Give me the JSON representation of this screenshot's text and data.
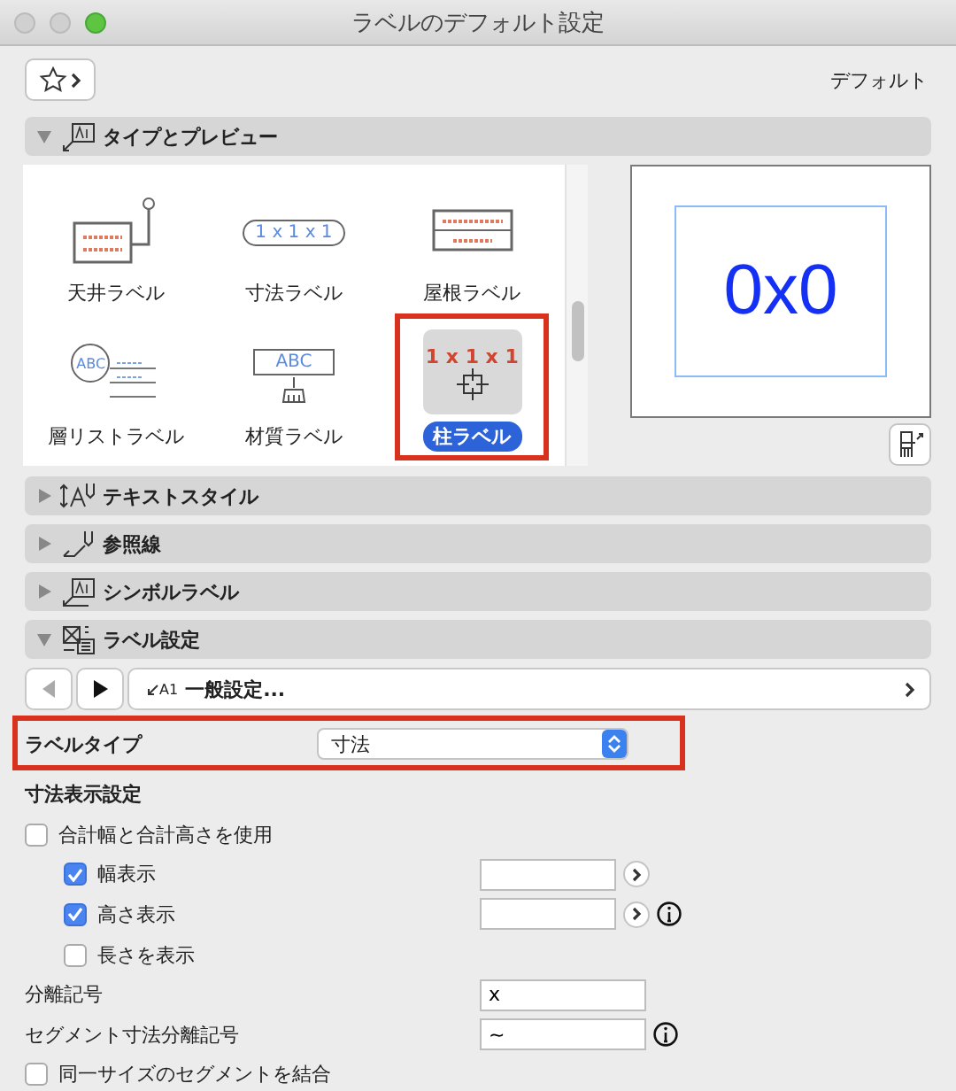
{
  "window": {
    "title": "ラベルのデフォルト設定"
  },
  "favorites": {
    "label": "デフォルト"
  },
  "sections": [
    {
      "kind": "preview",
      "title": "タイプとプレビュー",
      "expanded": true
    },
    {
      "kind": "textstyle",
      "title": "テキストスタイル",
      "expanded": false
    },
    {
      "kind": "leader",
      "title": "参照線",
      "expanded": false
    },
    {
      "kind": "symbol",
      "title": "シンボルラベル",
      "expanded": false
    },
    {
      "kind": "settings",
      "title": "ラベル設定",
      "expanded": true
    }
  ],
  "label_types": [
    {
      "label": "天井ラベル",
      "kind": "ceiling",
      "selected": false,
      "highlighted": false
    },
    {
      "label": "寸法ラベル",
      "kind": "dimension",
      "thumb_text": "1 x 1 x 1",
      "selected": false,
      "highlighted": false
    },
    {
      "label": "屋根ラベル",
      "kind": "roof",
      "selected": false,
      "highlighted": false
    },
    {
      "label": "層リストラベル",
      "kind": "story",
      "thumb_text": "ABC",
      "selected": false,
      "highlighted": false
    },
    {
      "label": "材質ラベル",
      "kind": "material",
      "thumb_text": "ABC",
      "selected": false,
      "highlighted": false
    },
    {
      "label": "柱ラベル",
      "kind": "column",
      "thumb_text": "1 x 1 x 1",
      "selected": true,
      "highlighted": true
    }
  ],
  "preview": {
    "text": "0x0"
  },
  "page_nav": {
    "label": "一般設定...",
    "icon_text": "A1"
  },
  "label_type": {
    "label": "ラベルタイプ",
    "value": "寸法",
    "highlighted": true
  },
  "dimension_settings": {
    "title": "寸法表示設定",
    "rows": [
      {
        "kind": "check",
        "label": "合計幅と合計高さを使用",
        "checked": false
      },
      {
        "kind": "subcheck",
        "label": "幅表示",
        "checked": true,
        "field": "",
        "arrow": true
      },
      {
        "kind": "subcheck",
        "label": "高さ表示",
        "checked": true,
        "field": "",
        "arrow": true,
        "info": true
      },
      {
        "kind": "subcheck",
        "label": "長さを表示",
        "checked": false
      },
      {
        "kind": "text",
        "label": "分離記号",
        "value": "x"
      },
      {
        "kind": "text",
        "label": "セグメント寸法分離記号",
        "value": "~",
        "info": true
      },
      {
        "kind": "check",
        "label": "同一サイズのセグメントを結合",
        "checked": false
      }
    ]
  }
}
